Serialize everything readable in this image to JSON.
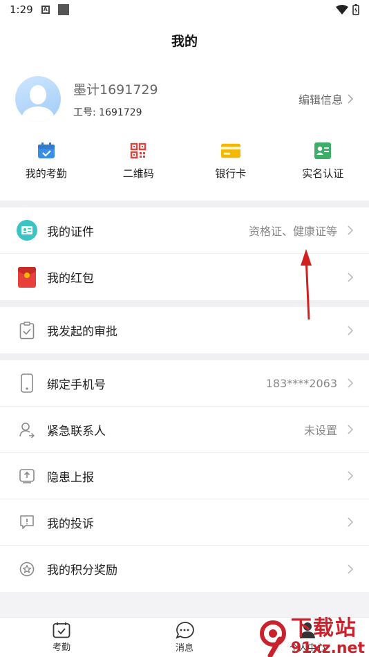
{
  "status_bar": {
    "time": "1:29",
    "a_icon_letter": "A"
  },
  "header": {
    "title": "我的"
  },
  "profile": {
    "name": "墨计1691729",
    "id_text": "工号: 1691729",
    "edit_label": "编辑信息"
  },
  "quick_actions": [
    {
      "label": "我的考勤",
      "icon": "calendar-check-icon"
    },
    {
      "label": "二维码",
      "icon": "qr-code-icon"
    },
    {
      "label": "银行卡",
      "icon": "bank-card-icon"
    },
    {
      "label": "实名认证",
      "icon": "id-verify-icon"
    }
  ],
  "menu_group_1": [
    {
      "label": "我的证件",
      "value": "资格证、健康证等",
      "icon": "certificate-icon"
    },
    {
      "label": "我的红包",
      "value": "",
      "icon": "red-packet-icon"
    }
  ],
  "menu_group_2": [
    {
      "label": "我发起的审批",
      "value": "",
      "icon": "clipboard-check-icon"
    }
  ],
  "menu_group_3": [
    {
      "label": "绑定手机号",
      "value": "183****2063",
      "icon": "phone-icon"
    },
    {
      "label": "紧急联系人",
      "value": "未设置",
      "icon": "contact-icon"
    },
    {
      "label": "隐患上报",
      "value": "",
      "icon": "report-upload-icon"
    },
    {
      "label": "我的投诉",
      "value": "",
      "icon": "complaint-icon"
    },
    {
      "label": "我的积分奖励",
      "value": "",
      "icon": "points-star-icon"
    }
  ],
  "tabbar": [
    {
      "label": "考勤",
      "icon": "attendance-icon"
    },
    {
      "label": "消息",
      "icon": "message-icon"
    },
    {
      "label": "个人中心",
      "icon": "person-icon"
    }
  ],
  "watermark": {
    "title": "下载站",
    "domain": "91xz.net",
    "logo_text": "9"
  },
  "colors": {
    "accent_blue": "#3a8ee6",
    "red": "#e8413b",
    "yellow": "#f5b800",
    "green": "#3cae68",
    "teal": "#3cc4c4",
    "annotation_red": "#d12020"
  }
}
